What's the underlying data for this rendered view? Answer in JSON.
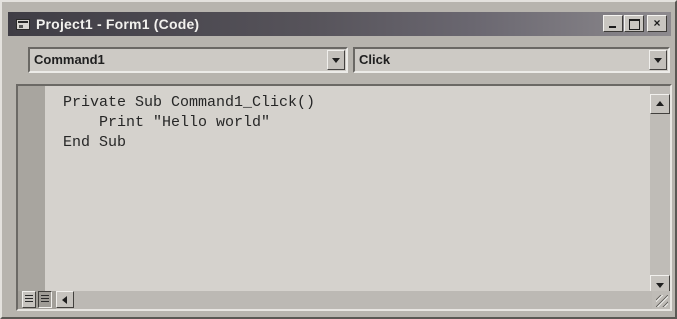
{
  "window": {
    "title": "Project1 - Form1 (Code)",
    "icon": "form-icon",
    "controls": [
      "minimize-icon",
      "maximize-icon",
      "close-icon"
    ]
  },
  "object_dropdown": {
    "selected": "Command1"
  },
  "procedure_dropdown": {
    "selected": "Click"
  },
  "code": {
    "lines": [
      "Private Sub Command1_Click()",
      "    Print \"Hello world\"",
      "End Sub"
    ]
  },
  "status_bar": {
    "view_buttons": [
      "procedure-view-icon",
      "full-module-view-icon"
    ]
  },
  "colors": {
    "title_gradient_start": "#3f3d45",
    "title_gradient_end": "#8d8a8e",
    "code_background": "#d5d2cd",
    "chrome": "#b7b4ae"
  }
}
